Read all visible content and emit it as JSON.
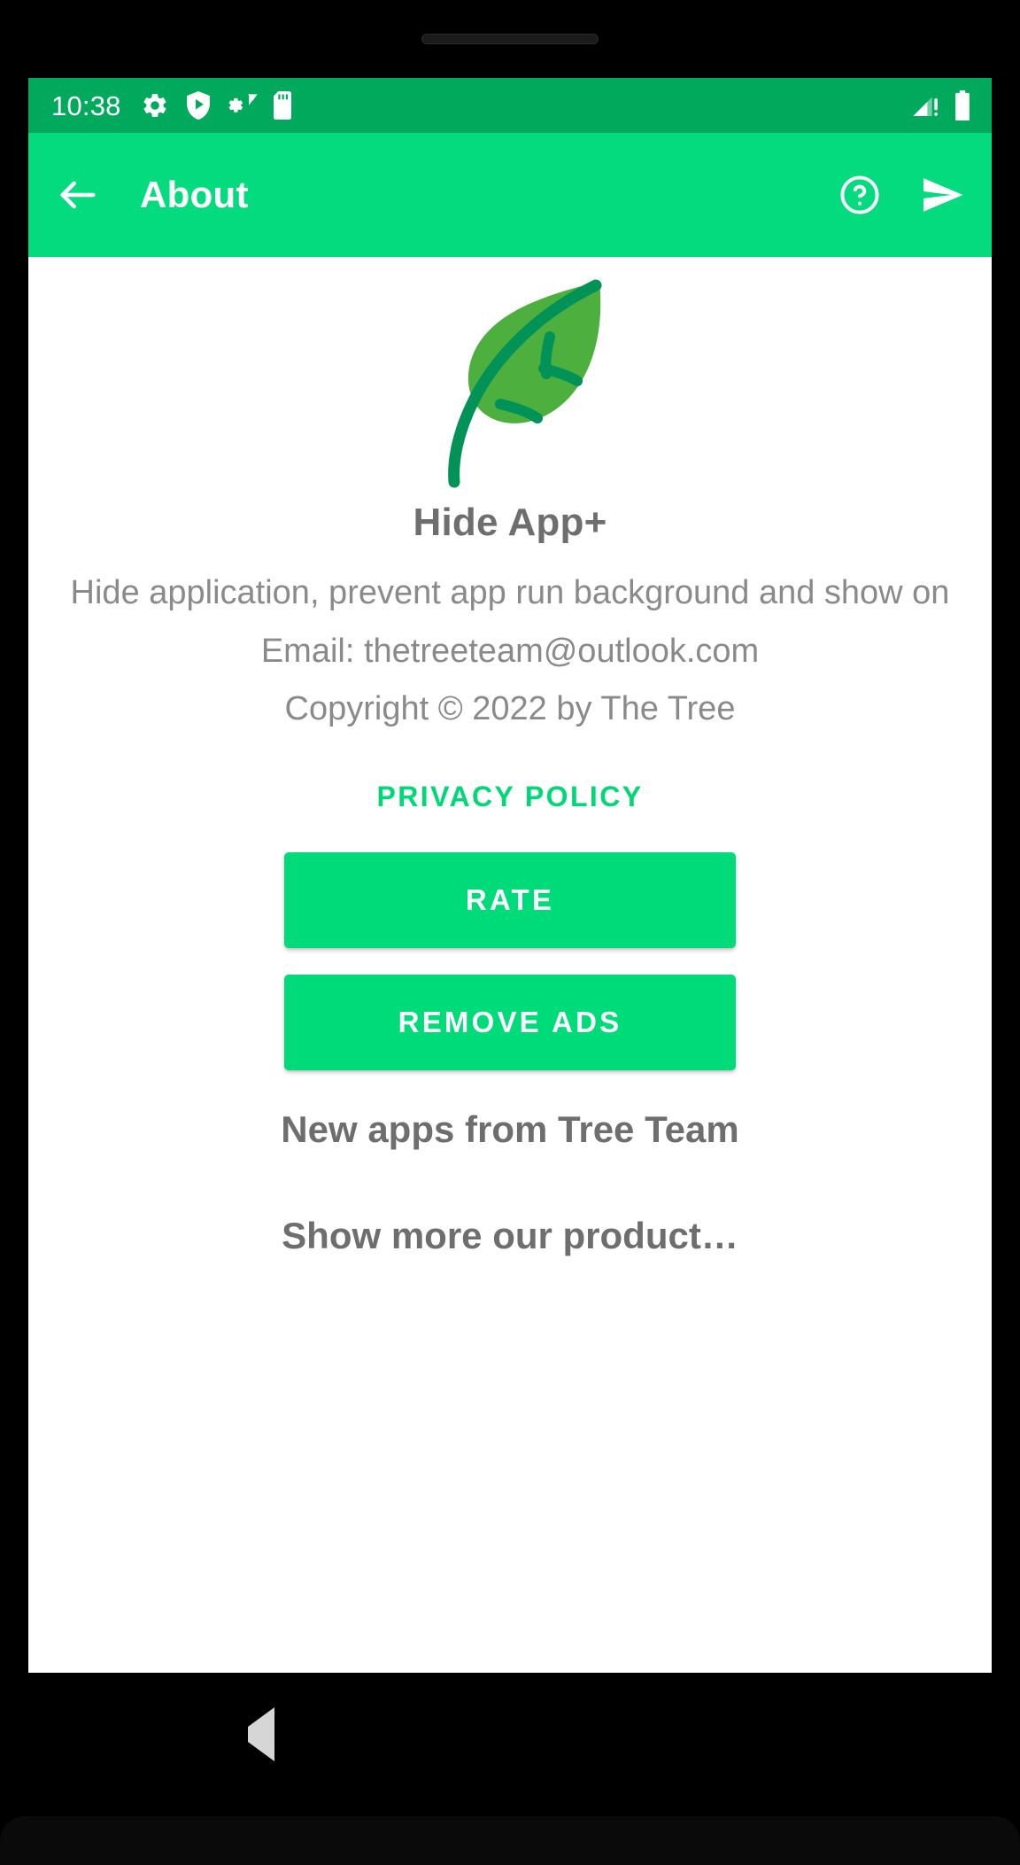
{
  "colors": {
    "status_bar_bg": "#00A95C",
    "app_bar_bg": "#04DB7E",
    "accent_green": "#00D877",
    "button_green": "#00DB7A",
    "text_gray": "#8A8A8A",
    "heading_gray": "#6E6E6E",
    "leaf_green": "#4CAF3E",
    "leaf_stem": "#00875A",
    "screen_bg": "#FFFFFF",
    "nav_bg": "#000000",
    "nav_icon": "#D6D6D6"
  },
  "status_bar": {
    "time": "10:38",
    "left_icons": [
      "gear-icon",
      "shield-play-icon",
      "settings-wifi-icon",
      "sd-card-icon"
    ],
    "right_icons": [
      "signal-alert-icon",
      "battery-full-icon"
    ]
  },
  "app_bar": {
    "back_icon": "arrow-left-icon",
    "title": "About",
    "actions": [
      {
        "icon": "help-circle-icon",
        "name": "help-button"
      },
      {
        "icon": "send-icon",
        "name": "share-button"
      }
    ]
  },
  "content": {
    "logo_icon": "leaf-logo",
    "app_name": "Hide App+",
    "description": "Hide application, prevent app run background and show on",
    "email": "Email: thetreeteam@outlook.com",
    "copyright": "Copyright © 2022 by The Tree",
    "privacy_policy_label": "PRIVACY POLICY",
    "buttons": [
      {
        "label": "RATE",
        "name": "rate-button"
      },
      {
        "label": "REMOVE ADS",
        "name": "remove-ads-button"
      }
    ],
    "new_apps_heading": "New apps from Tree Team",
    "show_more_label": "Show more our product…"
  },
  "nav_bar": {
    "back_label": "back-triangle",
    "home_label": "home-circle",
    "recents_label": "recents-square"
  }
}
